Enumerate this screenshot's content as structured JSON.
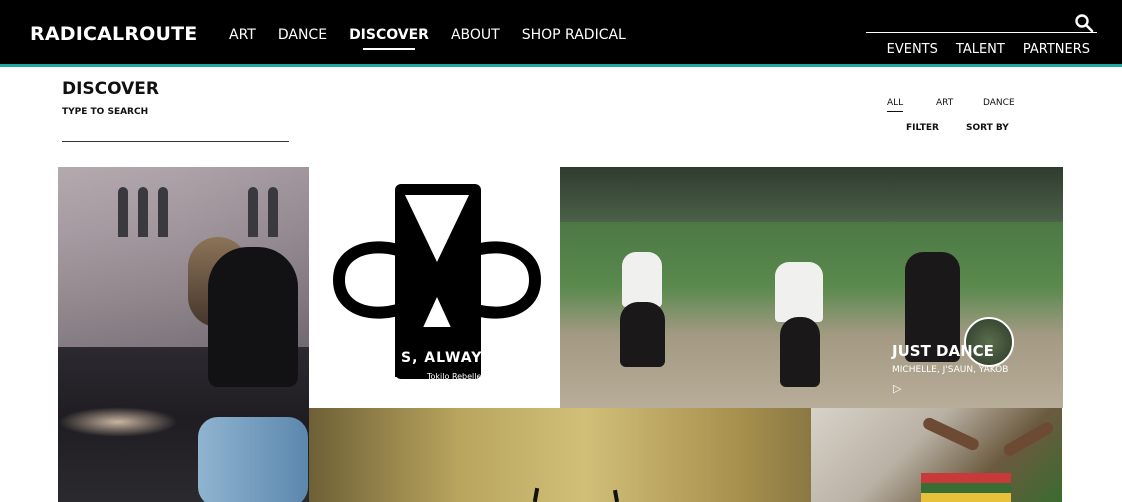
{
  "header": {
    "brand": "RADICALROUTE",
    "nav": [
      "ART",
      "DANCE",
      "DISCOVER",
      "ABOUT",
      "SHOP RADICAL"
    ],
    "active_nav": "DISCOVER",
    "subnav": [
      "EVENTS",
      "TALENT",
      "PARTNERS"
    ],
    "search_icon": "search-icon"
  },
  "discover": {
    "title": "DISCOVER",
    "search_label": "TYPE TO SEARCH",
    "search_value": "",
    "filters": [
      "ALL",
      "ART",
      "DANCE"
    ],
    "active_filter": "ALL",
    "filter_label": "FILTER",
    "sort_label": "SORT BY"
  },
  "tiles": {
    "t2": {
      "text": "S, ALWAYS",
      "subtext": "Tokilo Rebelle"
    },
    "t3": {
      "title": "JUST DANCE",
      "people": "MICHELLE, J'SAUN, YAKOB",
      "play_icon": "play-icon"
    }
  },
  "colors": {
    "topbar": "#000000",
    "accent": "#1fa8a8"
  }
}
